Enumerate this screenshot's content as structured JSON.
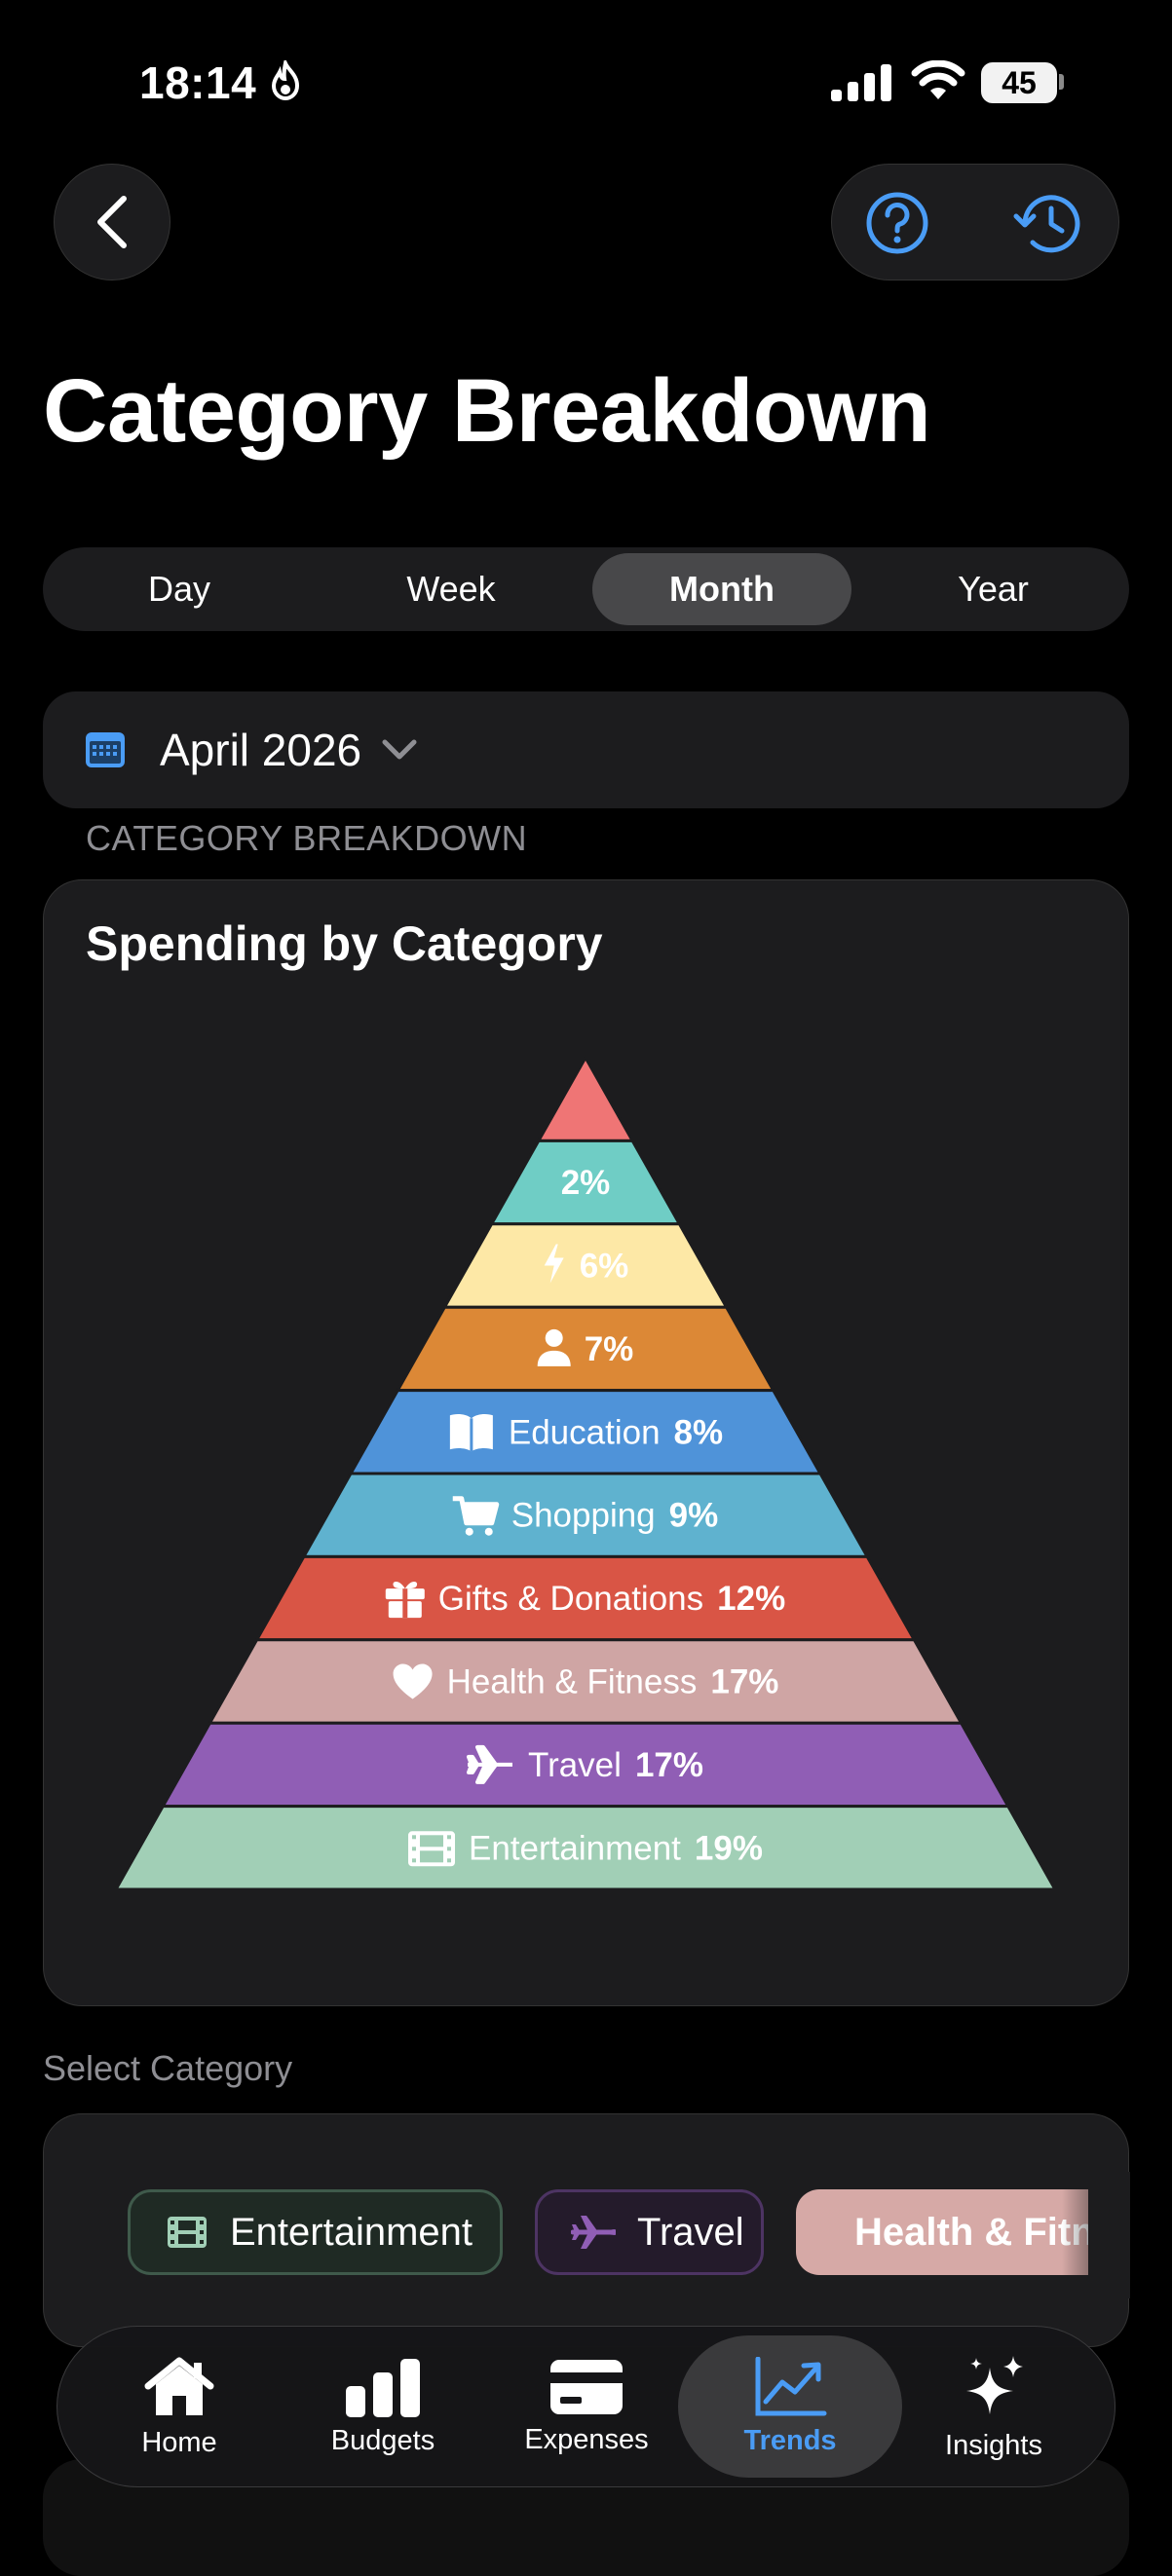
{
  "status_bar": {
    "time": "18:14",
    "battery": "45"
  },
  "page": {
    "title": "Category Breakdown"
  },
  "segment": {
    "items": [
      "Day",
      "Week",
      "Month",
      "Year"
    ],
    "selected": "Month"
  },
  "date_picker": {
    "value": "April 2026"
  },
  "section_label": "CATEGORY BREAKDOWN",
  "chart_card": {
    "title": "Spending by Category"
  },
  "chart_data": {
    "type": "pyramid",
    "title": "Spending by Category",
    "segments": [
      {
        "label": "",
        "pct": "",
        "value": 1,
        "color": "#ef7575",
        "icon": "none"
      },
      {
        "label": "",
        "pct": "2%",
        "value": 2,
        "color": "#6fcdc5",
        "icon": "none"
      },
      {
        "label": "",
        "pct": "6%",
        "value": 6,
        "color": "#fde8a6",
        "icon": "bolt-icon"
      },
      {
        "label": "",
        "pct": "7%",
        "value": 7,
        "color": "#dc8836",
        "icon": "person-icon"
      },
      {
        "label": "Education",
        "pct": "8%",
        "value": 8,
        "color": "#4f93d9",
        "icon": "book-icon"
      },
      {
        "label": "Shopping",
        "pct": "9%",
        "value": 9,
        "color": "#5fb2cf",
        "icon": "cart-icon"
      },
      {
        "label": "Gifts & Donations",
        "pct": "12%",
        "value": 12,
        "color": "#d95545",
        "icon": "gift-icon"
      },
      {
        "label": "Health & Fitness",
        "pct": "17%",
        "value": 17,
        "color": "#cfa5a4",
        "icon": "heart-icon"
      },
      {
        "label": "Travel",
        "pct": "17%",
        "value": 17,
        "color": "#905eb5",
        "icon": "airplane-icon"
      },
      {
        "label": "Entertainment",
        "pct": "19%",
        "value": 19,
        "color": "#a1cfb6",
        "icon": "film-icon"
      }
    ]
  },
  "select_category": {
    "label": "Select Category",
    "chips": [
      {
        "label": "Entertainment",
        "icon": "film-icon",
        "color": "#a1cfb6"
      },
      {
        "label": "Travel",
        "icon": "airplane-icon",
        "color": "#905eb5"
      },
      {
        "label": "Health & Fitness",
        "icon": "heart-icon",
        "color": "#d6a9a6"
      }
    ]
  },
  "tabbar": {
    "items": [
      {
        "label": "Home",
        "icon": "house-icon"
      },
      {
        "label": "Budgets",
        "icon": "bar-chart-icon"
      },
      {
        "label": "Expenses",
        "icon": "credit-card-icon"
      },
      {
        "label": "Trends",
        "icon": "trend-line-icon"
      },
      {
        "label": "Insights",
        "icon": "sparkles-icon"
      }
    ],
    "active": "Trends"
  },
  "colors": {
    "accent": "#4a9cf5",
    "background": "#000000",
    "card": "#1c1c1e"
  }
}
